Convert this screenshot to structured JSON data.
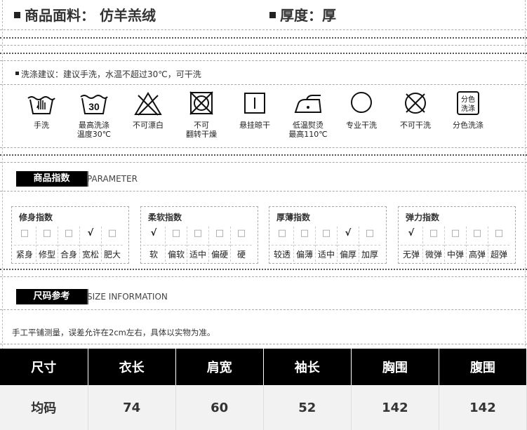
{
  "header": {
    "fabric_label": "商品面料：",
    "fabric_value": "仿羊羔绒",
    "thickness_label": "厚度：",
    "thickness_value": "厚"
  },
  "wash": {
    "title": "洗涤建议：建议手洗，水温不超过30℃，可干洗",
    "items": [
      {
        "icon": "hand-wash-icon",
        "label": "手洗"
      },
      {
        "icon": "wash-30-icon",
        "label": "最高洗涤\n温度30℃",
        "icon_text": "30"
      },
      {
        "icon": "no-bleach-icon",
        "label": "不可漂白"
      },
      {
        "icon": "no-tumble-dry-icon",
        "label": "不可\n翻转干燥"
      },
      {
        "icon": "hang-dry-icon",
        "label": "悬挂晾干"
      },
      {
        "icon": "low-iron-icon",
        "label": "低温熨烫\n最高110℃"
      },
      {
        "icon": "dry-clean-icon",
        "label": "专业干洗"
      },
      {
        "icon": "no-dry-clean-icon",
        "label": "不可干洗"
      },
      {
        "icon": "wash-separately-icon",
        "label": "分色洗涤",
        "icon_text_1": "分色",
        "icon_text_2": "洗涤"
      }
    ]
  },
  "parameter": {
    "tag": "商品指数",
    "en": "PARAMETER",
    "groups": [
      {
        "title": "修身指数",
        "options": [
          "紧身",
          "修型",
          "合身",
          "宽松",
          "肥大"
        ],
        "selected": 3
      },
      {
        "title": "柔软指数",
        "options": [
          "软",
          "偏软",
          "适中",
          "偏硬",
          "硬"
        ],
        "selected": 0
      },
      {
        "title": "厚薄指数",
        "options": [
          "较透",
          "偏薄",
          "适中",
          "偏厚",
          "加厚"
        ],
        "selected": 3
      },
      {
        "title": "弹力指数",
        "options": [
          "无弹",
          "微弹",
          "中弹",
          "高弹",
          "超弹"
        ],
        "selected": 0
      }
    ],
    "mark_on": "√",
    "mark_off": "□"
  },
  "size": {
    "tag": "尺码参考",
    "en": "SIZE INFORMATION",
    "note": "手工平铺测量，误差允许在2cm左右，具体以实物为准。",
    "headers": [
      "尺寸",
      "衣长",
      "肩宽",
      "袖长",
      "胸围",
      "腹围"
    ],
    "rows": [
      [
        "均码",
        "74",
        "60",
        "52",
        "142",
        "142"
      ]
    ]
  }
}
